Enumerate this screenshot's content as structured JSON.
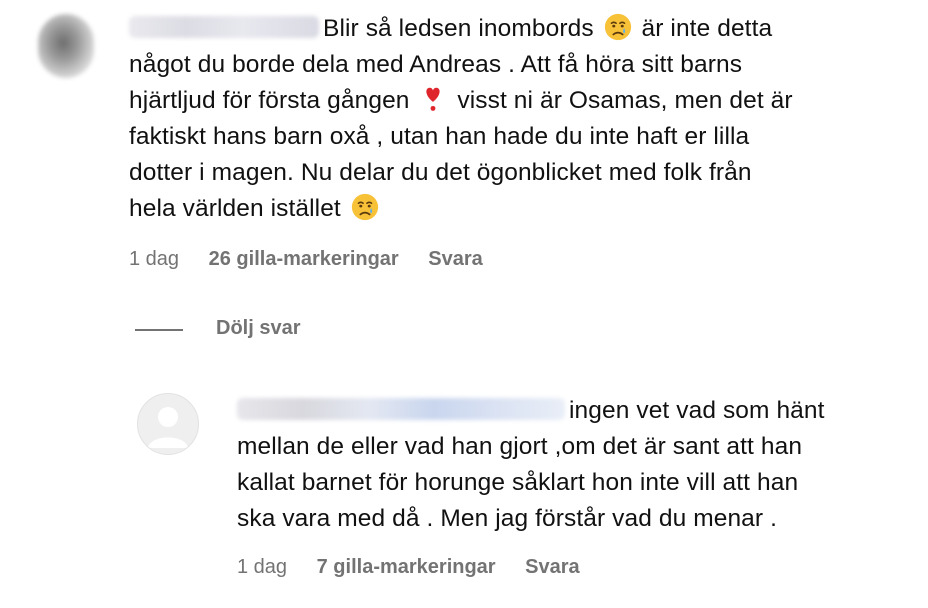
{
  "comment": {
    "text_lines": [
      "Blir så ledsen inombords",
      "är inte detta",
      "något du borde dela med Andreas . Att få höra sitt barns",
      "hjärtljud för första gången",
      "visst ni är Osamas, men det är",
      "faktiskt hans barn oxå , utan han hade du inte haft er lilla",
      "dotter i magen. Nu delar du det ögonblicket med folk från",
      "hela världen istället"
    ],
    "time": "1 dag",
    "likes": "26 gilla-markeringar",
    "reply": "Svara"
  },
  "hide_replies": "Dölj svar",
  "reply_comment": {
    "text_lines": [
      "ingen vet vad som hänt",
      "mellan de eller vad han gjort ,om det är sant att han",
      "kallat barnet för horunge såklart hon inte vill att han",
      "ska vara med då . Men jag förstår vad du menar ."
    ],
    "time": "1 dag",
    "likes": "7 gilla-markeringar",
    "reply": "Svara"
  },
  "icons": {
    "emoji_1": "crying-face-icon",
    "emoji_2": "red-heart-exclamation-icon",
    "emoji_3": "crying-face-icon",
    "default_avatar": "default-avatar-icon"
  },
  "colors": {
    "text": "#111111",
    "meta": "#737373",
    "heart": "#e0242c",
    "emoji_face": "#f7c138"
  }
}
